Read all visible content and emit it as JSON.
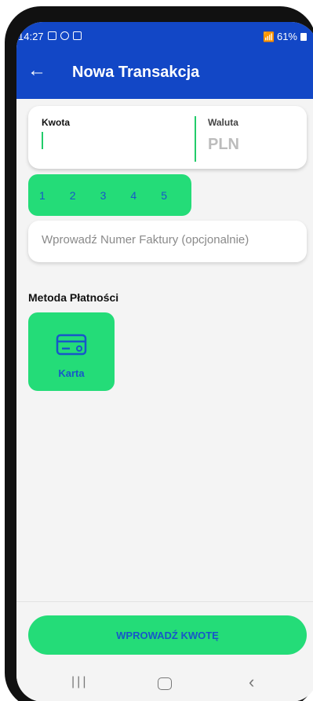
{
  "status_bar": {
    "time": "14:27",
    "signal": "📶",
    "battery": "61%"
  },
  "app_bar": {
    "back_icon": "arrow-left-icon",
    "title": "Nowa Transakcja"
  },
  "amount_card": {
    "amount_label": "Kwota",
    "amount_value": "",
    "currency_label": "Waluta",
    "currency_value": "PLN"
  },
  "number_pills": [
    "1",
    "2",
    "3",
    "4",
    "5"
  ],
  "invoice": {
    "placeholder": "Wprowadź Numer Faktury (opcjonalnie)",
    "value": ""
  },
  "payment": {
    "section_title": "Metoda Płatności",
    "methods": [
      {
        "label": "Karta",
        "icon": "credit-card-icon"
      }
    ]
  },
  "cta": {
    "label": "WPROWADŹ KWOTĘ"
  },
  "colors": {
    "primary_blue": "#1247c6",
    "accent_green": "#24dc78",
    "text_blue": "#1757c9"
  }
}
